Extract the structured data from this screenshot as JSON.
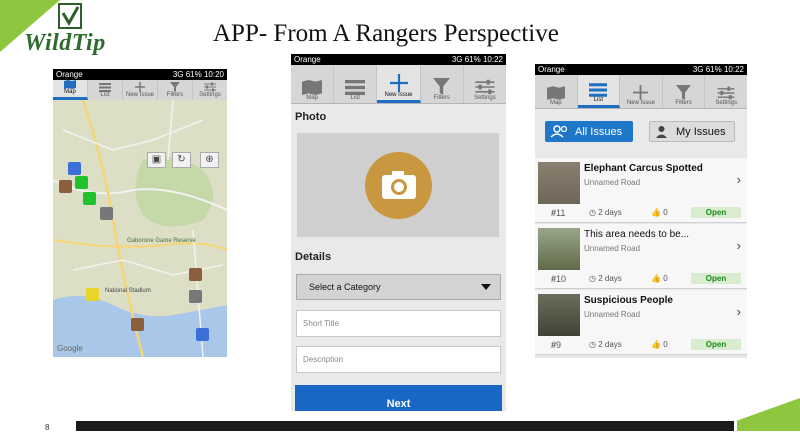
{
  "slide": {
    "logo_text": "WildTip",
    "title": "APP- From A Rangers Perspective",
    "page_number": "8"
  },
  "colors": {
    "accent_green": "#8fc63f",
    "nav_active": "#1e6fc4",
    "open_green": "#1a8a1a",
    "camera_gold": "#c9973f"
  },
  "status_bar": {
    "carrier": "Orange",
    "battery": "61%",
    "phone1_time": "10:20",
    "phone2_time": "10:22",
    "phone3_time": "10:22",
    "network": "3G"
  },
  "phone1": {
    "nav": [
      {
        "label": "Map",
        "icon": "map-icon"
      },
      {
        "label": "List",
        "icon": "list-icon"
      },
      {
        "label": "New Issue",
        "icon": "plus-icon"
      },
      {
        "label": "Filters",
        "icon": "filter-icon"
      },
      {
        "label": "Settings",
        "icon": "sliders-icon"
      }
    ],
    "map_labels": {
      "reserve": "Gaborone Game Reserve",
      "stadium": "National Stadium",
      "google": "Google"
    }
  },
  "phone2": {
    "nav": [
      {
        "label": "Map",
        "icon": "map-icon"
      },
      {
        "label": "List",
        "icon": "list-icon"
      },
      {
        "label": "New Issue",
        "icon": "plus-icon"
      },
      {
        "label": "Filters",
        "icon": "filter-icon"
      },
      {
        "label": "Settings",
        "icon": "sliders-icon"
      }
    ],
    "photo_label": "Photo",
    "details_label": "Details",
    "category_select": "Select a Category",
    "short_title_placeholder": "Short Title",
    "description_placeholder": "Description",
    "next_button": "Next"
  },
  "phone3": {
    "nav": [
      {
        "label": "Map",
        "icon": "map-icon"
      },
      {
        "label": "List",
        "icon": "list-icon"
      },
      {
        "label": "New Issue",
        "icon": "plus-icon"
      },
      {
        "label": "Filters",
        "icon": "filter-icon"
      },
      {
        "label": "Settings",
        "icon": "sliders-icon"
      }
    ],
    "all_issues": "All Issues",
    "my_issues": "My Issues",
    "issues": [
      {
        "title": "Elephant Carcus Spotted",
        "road": "Unnamed Road",
        "number": "11",
        "time": "2 days",
        "likes": "0",
        "status": "Open"
      },
      {
        "title": "This area needs to be...",
        "road": "Unnamed Road",
        "number": "10",
        "time": "2 days",
        "likes": "0",
        "status": "Open"
      },
      {
        "title": "Suspicious People",
        "road": "Unnamed Road",
        "number": "9",
        "time": "2 days",
        "likes": "0",
        "status": "Open"
      }
    ]
  }
}
